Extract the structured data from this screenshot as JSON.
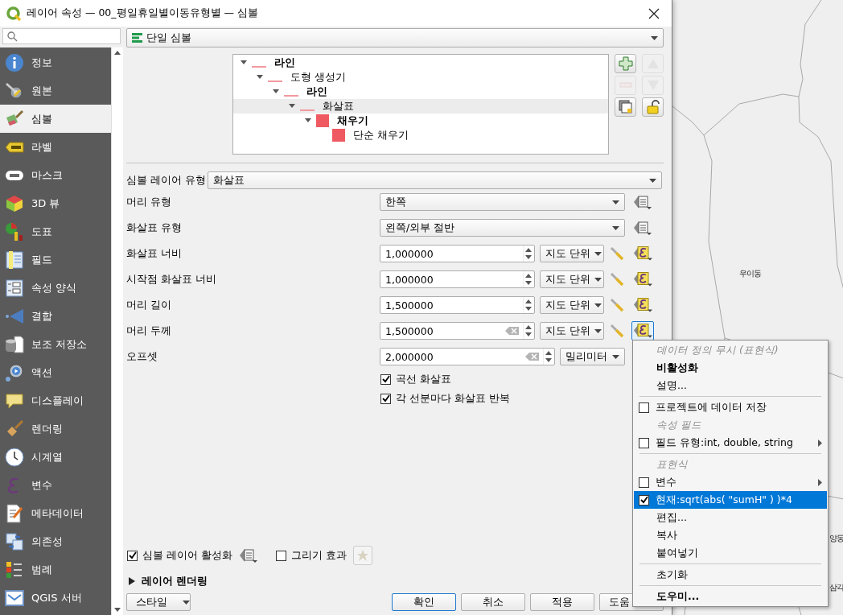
{
  "window": {
    "title": "레이어 속성 — 00_평일휴일별이동유형별 — 심볼"
  },
  "sidebar": {
    "items": [
      {
        "label": "정보",
        "selected": false
      },
      {
        "label": "원본",
        "selected": false
      },
      {
        "label": "심볼",
        "selected": true
      },
      {
        "label": "라벨",
        "selected": false
      },
      {
        "label": "마스크",
        "selected": false
      },
      {
        "label": "3D 뷰",
        "selected": false
      },
      {
        "label": "도표",
        "selected": false
      },
      {
        "label": "필드",
        "selected": false
      },
      {
        "label": "속성 양식",
        "selected": false
      },
      {
        "label": "결합",
        "selected": false
      },
      {
        "label": "보조 저장소",
        "selected": false
      },
      {
        "label": "액션",
        "selected": false
      },
      {
        "label": "디스플레이",
        "selected": false
      },
      {
        "label": "렌더링",
        "selected": false
      },
      {
        "label": "시계열",
        "selected": false
      },
      {
        "label": "변수",
        "selected": false
      },
      {
        "label": "메타데이터",
        "selected": false
      },
      {
        "label": "의존성",
        "selected": false
      },
      {
        "label": "범례",
        "selected": false
      },
      {
        "label": "QGIS 서버",
        "selected": false
      }
    ]
  },
  "renderer": {
    "value": "단일 심볼"
  },
  "symbol_tree": [
    {
      "label": "라인",
      "kind": "line-symbol",
      "selected": false,
      "children": [
        {
          "label": "도형 생성기",
          "kind": "line-layer",
          "selected": false,
          "children": [
            {
              "label": "라인",
              "kind": "line-symbol",
              "selected": false,
              "children": [
                {
                  "label": "화살표",
                  "kind": "line-layer",
                  "selected": true,
                  "children": [
                    {
                      "label": "채우기",
                      "kind": "fill-symbol",
                      "selected": false,
                      "children": [
                        {
                          "label": "단순 채우기",
                          "kind": "fill-layer",
                          "selected": false
                        }
                      ]
                    }
                  ]
                }
              ]
            }
          ]
        }
      ]
    }
  ],
  "tree_buttons": [
    {
      "kind": "add",
      "disabled": false
    },
    {
      "kind": "up",
      "disabled": true
    },
    {
      "kind": "remove",
      "disabled": true
    },
    {
      "kind": "down",
      "disabled": true
    },
    {
      "kind": "duplicate",
      "disabled": false
    },
    {
      "kind": "lock",
      "disabled": false
    }
  ],
  "layer_type": {
    "label": "심볼 레이어 유형",
    "value": "화살표"
  },
  "properties": [
    {
      "label": "머리 유형",
      "kind": "combo",
      "value": "한쪽",
      "override": {
        "kind": "list",
        "focused": false
      }
    },
    {
      "label": "화살표 유형",
      "kind": "combo",
      "value": "왼쪽/외부 절반",
      "override": {
        "kind": "list",
        "focused": false
      }
    },
    {
      "label": "화살표 너비",
      "kind": "spin",
      "value": "1,000000",
      "unit": "지도 단위",
      "clearable": false,
      "wrench": true,
      "override": {
        "kind": "expression",
        "focused": false
      }
    },
    {
      "label": "시작점 화살표 너비",
      "kind": "spin",
      "value": "1,000000",
      "unit": "지도 단위",
      "clearable": false,
      "wrench": true,
      "override": {
        "kind": "expression",
        "focused": false
      }
    },
    {
      "label": "머리 길이",
      "kind": "spin",
      "value": "1,500000",
      "unit": "지도 단위",
      "clearable": false,
      "wrench": true,
      "override": {
        "kind": "expression",
        "focused": false
      }
    },
    {
      "label": "머리 두께",
      "kind": "spin",
      "value": "1,500000",
      "unit": "지도 단위",
      "clearable": true,
      "wrench": true,
      "override": {
        "kind": "expression",
        "focused": true
      }
    },
    {
      "label": "오프셋",
      "kind": "spin",
      "value": "2,000000",
      "unit": "밀리미터",
      "clearable": true,
      "wrench": false
    }
  ],
  "options": [
    {
      "label": "곡선 화살표",
      "checked": true
    },
    {
      "label": "각 선분마다 화살표 반복",
      "checked": true
    }
  ],
  "layer_enabled": {
    "label": "심볼 레이어 활성화",
    "checked": true
  },
  "draw_effects": {
    "label": "그리기 효과",
    "checked": false
  },
  "rendering_section": {
    "label": "레이어 렌더링",
    "expanded": false
  },
  "style_button": {
    "label": "스타일"
  },
  "buttons": [
    {
      "label": "확인",
      "default": true
    },
    {
      "label": "취소",
      "default": false
    },
    {
      "label": "적용",
      "default": false
    },
    {
      "label": "도움",
      "default": false
    }
  ],
  "override_menu": {
    "items": [
      {
        "kind": "header",
        "label": "데이터 정의 무시 (표현식)"
      },
      {
        "kind": "action",
        "label": "비활성화",
        "bold": true,
        "selected": false
      },
      {
        "kind": "action",
        "label": "설명...",
        "bold": false,
        "selected": false
      },
      {
        "kind": "separator"
      },
      {
        "kind": "check",
        "label": "프로젝트에 데이터 저장",
        "checked": false,
        "submenu": false,
        "selected": false
      },
      {
        "kind": "header",
        "label": "속성 필드"
      },
      {
        "kind": "check",
        "label": "필드 유형:int, double, string",
        "checked": false,
        "submenu": true,
        "selected": false
      },
      {
        "kind": "separator"
      },
      {
        "kind": "header",
        "label": "표현식"
      },
      {
        "kind": "check",
        "label": "변수",
        "checked": false,
        "submenu": true,
        "selected": false
      },
      {
        "kind": "check",
        "label": "현재:sqrt(abs( \"sumH\" ) )*4",
        "checked": true,
        "submenu": false,
        "selected": true
      },
      {
        "kind": "action",
        "label": "편집...",
        "bold": false,
        "selected": false
      },
      {
        "kind": "action",
        "label": "복사",
        "bold": false,
        "selected": false
      },
      {
        "kind": "action",
        "label": "붙여넣기",
        "bold": false,
        "selected": false
      },
      {
        "kind": "separator"
      },
      {
        "kind": "action",
        "label": "초기화",
        "bold": false,
        "selected": false
      },
      {
        "kind": "separator"
      },
      {
        "kind": "action",
        "label": "도우미...",
        "bold": true,
        "selected": false
      }
    ]
  },
  "map": {
    "labels": [
      "우이동",
      "양동",
      "삼각"
    ]
  }
}
